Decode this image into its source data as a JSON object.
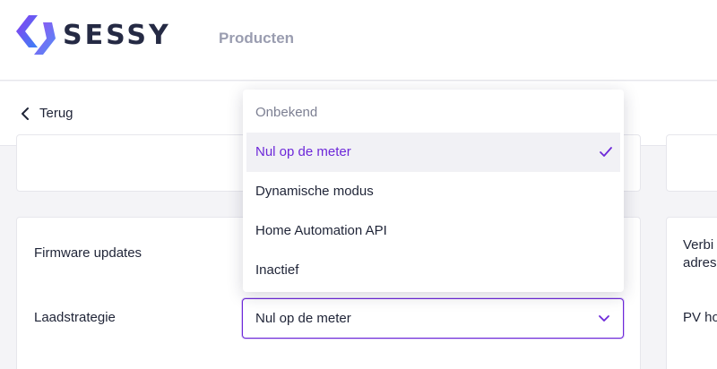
{
  "brand": {
    "name": "SESSY"
  },
  "nav": {
    "products": "Producten"
  },
  "back": {
    "label": "Terug"
  },
  "settings": {
    "firmware_label": "Firmware updates",
    "strategy_label": "Laadstrategie",
    "right_label_1a": "Verbi",
    "right_label_1b": "adres",
    "right_label_2": "PV ho"
  },
  "select": {
    "value": "Nul op de meter",
    "options": [
      {
        "label": "Onbekend",
        "placeholder": true
      },
      {
        "label": "Nul op de meter",
        "selected": true
      },
      {
        "label": "Dynamische modus"
      },
      {
        "label": "Home Automation API"
      },
      {
        "label": "Inactief"
      }
    ]
  },
  "colors": {
    "accent": "#6d28d9",
    "logo_from": "#7c3aed",
    "logo_to": "#3b82f6",
    "text": "#1f2437"
  }
}
